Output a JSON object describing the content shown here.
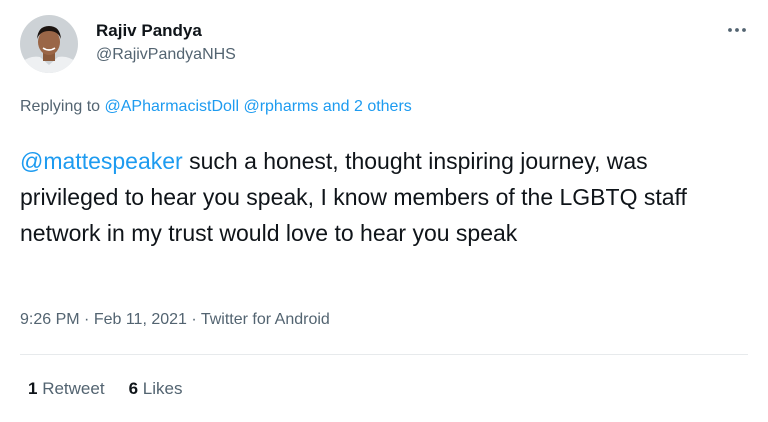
{
  "author": {
    "display_name": "Rajiv Pandya",
    "handle": "@RajivPandyaNHS"
  },
  "more_icon": "ellipsis-icon",
  "reply_context": {
    "prefix": "Replying to ",
    "user1": "@APharmacistDoll",
    "user2": "@rpharms",
    "connector": " and ",
    "others": "2 others"
  },
  "tweet": {
    "mention": "@mattespeaker",
    "text": " such a honest, thought inspiring journey, was privileged to hear you speak, I know members of the LGBTQ staff network in my trust would love to hear you speak"
  },
  "meta": {
    "time": "9:26 PM",
    "sep1": " · ",
    "date": "Feb 11, 2021",
    "sep2": " · ",
    "source": "Twitter for Android"
  },
  "stats": {
    "retweets_count": "1",
    "retweets_label": "Retweet",
    "likes_count": "6",
    "likes_label": "Likes"
  },
  "colors": {
    "link": "#1d9bf0",
    "secondary_text": "#536471",
    "primary_text": "#0f1419"
  }
}
